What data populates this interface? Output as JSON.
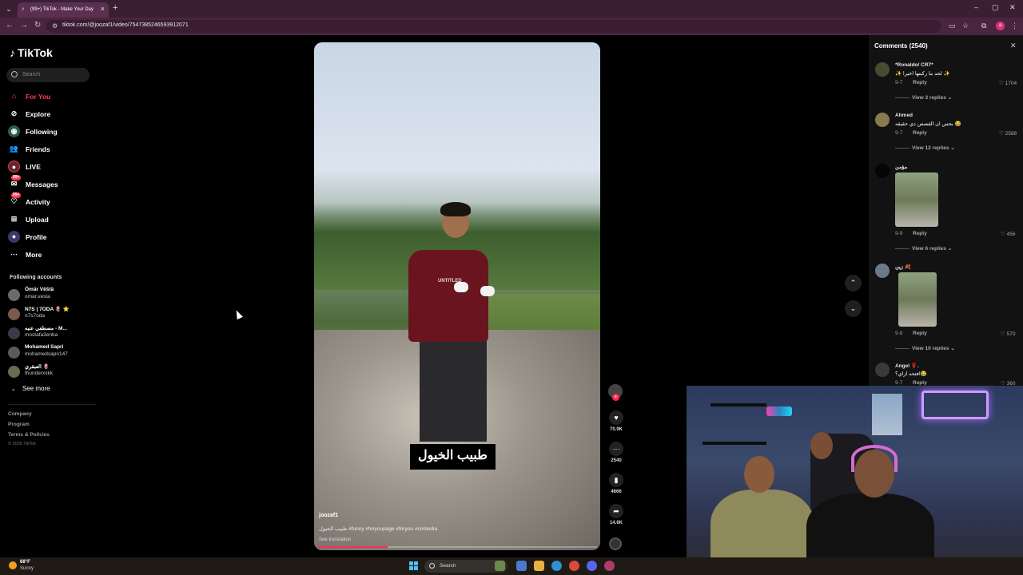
{
  "browser": {
    "tab_title": "(99+) TikTok - Make Your Day",
    "url": "tiktok.com/@joozaf1/video/7547385246593912071"
  },
  "sidebar": {
    "logo": "TikTok",
    "search_placeholder": "Search",
    "nav": [
      {
        "label": "For You",
        "icon": "home-icon",
        "active": true
      },
      {
        "label": "Explore",
        "icon": "compass-icon"
      },
      {
        "label": "Following",
        "icon": "following-icon"
      },
      {
        "label": "Friends",
        "icon": "friends-icon"
      },
      {
        "label": "LIVE",
        "icon": "live-icon"
      },
      {
        "label": "Messages",
        "icon": "message-icon",
        "badge": "99+"
      },
      {
        "label": "Activity",
        "icon": "activity-icon",
        "badge": "99+"
      },
      {
        "label": "Upload",
        "icon": "upload-icon"
      },
      {
        "label": "Profile",
        "icon": "profile-icon"
      },
      {
        "label": "More",
        "icon": "more-icon"
      }
    ],
    "following_title": "Following accounts",
    "accounts": [
      {
        "name": "Ömär Vêštâ",
        "handle": "omar.vesta"
      },
      {
        "name": "N7S | 7ODA 🌷 ⭐",
        "handle": "n7s7oda"
      },
      {
        "name": "مصطفي عنبه - M...",
        "handle": "mostafa3enba"
      },
      {
        "name": "Mohamed Sapri",
        "handle": "mohamedsapri147"
      },
      {
        "name": "العبقري 🌷",
        "handle": "thunderxxkk"
      }
    ],
    "see_more": "See more",
    "footer": [
      "Company",
      "Program",
      "Terms & Policies"
    ],
    "copyright": "© 2025 TikTok"
  },
  "video": {
    "caption": "طبيب الخيول",
    "shirt_text": "UNTITLED",
    "username": "joozaf1",
    "description": "طبيب الخيول #funny #foryoupage #foryou #comedia",
    "see_translation": "See translation",
    "progress": 0.25
  },
  "actions": {
    "likes": "70.9K",
    "comments": "2540",
    "saves": "4666",
    "shares": "14.6K"
  },
  "comments": {
    "title": "Comments (2540)",
    "items": [
      {
        "user": "*Ronaldo/ CR7*",
        "text": "✨ لحد ما ركبتها اخيرا ✨",
        "date": "9-7",
        "reply": "Reply",
        "likes": "1704",
        "view_replies": "View 3 replies"
      },
      {
        "user": "Ahmed",
        "text": "بحس ان القصص دي حقيقه 😂",
        "date": "9-7",
        "reply": "Reply",
        "likes": "2588",
        "view_replies": "View 12 replies"
      },
      {
        "user": "مؤمن",
        "text": "",
        "date": "9-9",
        "reply": "Reply",
        "likes": "456",
        "view_replies": "View 6 replies"
      },
      {
        "user": "زين 🍂",
        "text": "",
        "date": "9-8",
        "reply": "Reply",
        "likes": "570",
        "view_replies": "View 10 replies"
      },
      {
        "user": "Angel 🌹.",
        "text": "افتحه ازاي؟😂",
        "date": "9-7",
        "reply": "Reply",
        "likes": "360",
        "view_replies": ""
      }
    ]
  },
  "taskbar": {
    "temp": "68°F",
    "weather": "Sunny",
    "search": "Search"
  }
}
